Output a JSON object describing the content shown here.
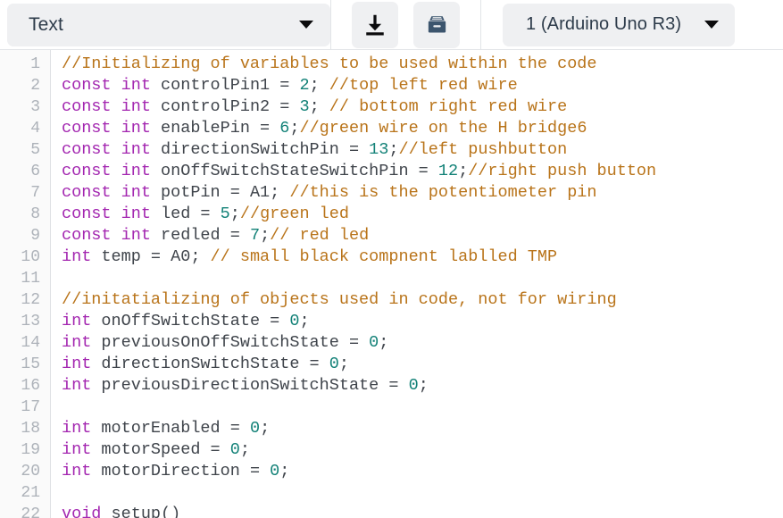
{
  "toolbar": {
    "type_selector": {
      "value": "Text",
      "icon": "chevron-down-icon"
    },
    "download_button": {
      "icon": "download-icon",
      "label": ""
    },
    "archive_button": {
      "icon": "archive-box-icon",
      "label": ""
    },
    "board_selector": {
      "value": "1 (Arduino Uno R3)",
      "icon": "chevron-down-icon"
    }
  },
  "editor": {
    "line_numbers": [
      "1",
      "2",
      "3",
      "4",
      "5",
      "6",
      "7",
      "8",
      "9",
      "10",
      "11",
      "12",
      "13",
      "14",
      "15",
      "16",
      "17",
      "18",
      "19",
      "20",
      "21",
      "22"
    ],
    "lines": [
      [
        {
          "t": "com",
          "v": "//Initializing of variables to be used within the code"
        }
      ],
      [
        {
          "t": "key",
          "v": "const int"
        },
        {
          "t": "id",
          "v": " controlPin1 = "
        },
        {
          "t": "num",
          "v": "2"
        },
        {
          "t": "punc",
          "v": "; "
        },
        {
          "t": "com",
          "v": "//top left red wire"
        }
      ],
      [
        {
          "t": "key",
          "v": "const int"
        },
        {
          "t": "id",
          "v": " controlPin2 = "
        },
        {
          "t": "num",
          "v": "3"
        },
        {
          "t": "punc",
          "v": "; "
        },
        {
          "t": "com",
          "v": "// bottom right red wire"
        }
      ],
      [
        {
          "t": "key",
          "v": "const int"
        },
        {
          "t": "id",
          "v": " enablePin = "
        },
        {
          "t": "num",
          "v": "6"
        },
        {
          "t": "punc",
          "v": ";"
        },
        {
          "t": "com",
          "v": "//green wire on the H bridge6"
        }
      ],
      [
        {
          "t": "key",
          "v": "const int"
        },
        {
          "t": "id",
          "v": " directionSwitchPin = "
        },
        {
          "t": "num",
          "v": "13"
        },
        {
          "t": "punc",
          "v": ";"
        },
        {
          "t": "com",
          "v": "//left pushbutton"
        }
      ],
      [
        {
          "t": "key",
          "v": "const int"
        },
        {
          "t": "id",
          "v": " onOffSwitchStateSwitchPin = "
        },
        {
          "t": "num",
          "v": "12"
        },
        {
          "t": "punc",
          "v": ";"
        },
        {
          "t": "com",
          "v": "//right push button"
        }
      ],
      [
        {
          "t": "key",
          "v": "const int"
        },
        {
          "t": "id",
          "v": " potPin = A1; "
        },
        {
          "t": "com",
          "v": "//this is the potentiometer pin"
        }
      ],
      [
        {
          "t": "key",
          "v": "const int"
        },
        {
          "t": "id",
          "v": " led = "
        },
        {
          "t": "num",
          "v": "5"
        },
        {
          "t": "punc",
          "v": ";"
        },
        {
          "t": "com",
          "v": "//green led"
        }
      ],
      [
        {
          "t": "key",
          "v": "const int"
        },
        {
          "t": "id",
          "v": " redled = "
        },
        {
          "t": "num",
          "v": "7"
        },
        {
          "t": "punc",
          "v": ";"
        },
        {
          "t": "com",
          "v": "// red led"
        }
      ],
      [
        {
          "t": "key",
          "v": "int"
        },
        {
          "t": "id",
          "v": " temp = A0; "
        },
        {
          "t": "com",
          "v": "// small black compnent lablled TMP"
        }
      ],
      [],
      [
        {
          "t": "com",
          "v": "//initatializing of objects used in code, not for wiring"
        }
      ],
      [
        {
          "t": "key",
          "v": "int"
        },
        {
          "t": "id",
          "v": " onOffSwitchState = "
        },
        {
          "t": "num",
          "v": "0"
        },
        {
          "t": "punc",
          "v": ";"
        }
      ],
      [
        {
          "t": "key",
          "v": "int"
        },
        {
          "t": "id",
          "v": " previousOnOffSwitchState = "
        },
        {
          "t": "num",
          "v": "0"
        },
        {
          "t": "punc",
          "v": ";"
        }
      ],
      [
        {
          "t": "key",
          "v": "int"
        },
        {
          "t": "id",
          "v": " directionSwitchState = "
        },
        {
          "t": "num",
          "v": "0"
        },
        {
          "t": "punc",
          "v": ";"
        }
      ],
      [
        {
          "t": "key",
          "v": "int"
        },
        {
          "t": "id",
          "v": " previousDirectionSwitchState = "
        },
        {
          "t": "num",
          "v": "0"
        },
        {
          "t": "punc",
          "v": ";"
        }
      ],
      [],
      [
        {
          "t": "key",
          "v": "int"
        },
        {
          "t": "id",
          "v": " motorEnabled = "
        },
        {
          "t": "num",
          "v": "0"
        },
        {
          "t": "punc",
          "v": ";"
        }
      ],
      [
        {
          "t": "key",
          "v": "int"
        },
        {
          "t": "id",
          "v": " motorSpeed = "
        },
        {
          "t": "num",
          "v": "0"
        },
        {
          "t": "punc",
          "v": ";"
        }
      ],
      [
        {
          "t": "key",
          "v": "int"
        },
        {
          "t": "id",
          "v": " motorDirection = "
        },
        {
          "t": "num",
          "v": "0"
        },
        {
          "t": "punc",
          "v": ";"
        }
      ],
      [],
      [
        {
          "t": "key",
          "v": "void"
        },
        {
          "t": "id",
          "v": " setup()"
        }
      ]
    ]
  },
  "colors": {
    "comment": "#b9741a",
    "keyword": "#a326b0",
    "number": "#128177",
    "identifier": "#3f444b",
    "line_number": "#adb2b9",
    "toolbar_control_bg": "#eff0f2",
    "archive_icon": "#3c556e",
    "background": "#ffffff"
  }
}
